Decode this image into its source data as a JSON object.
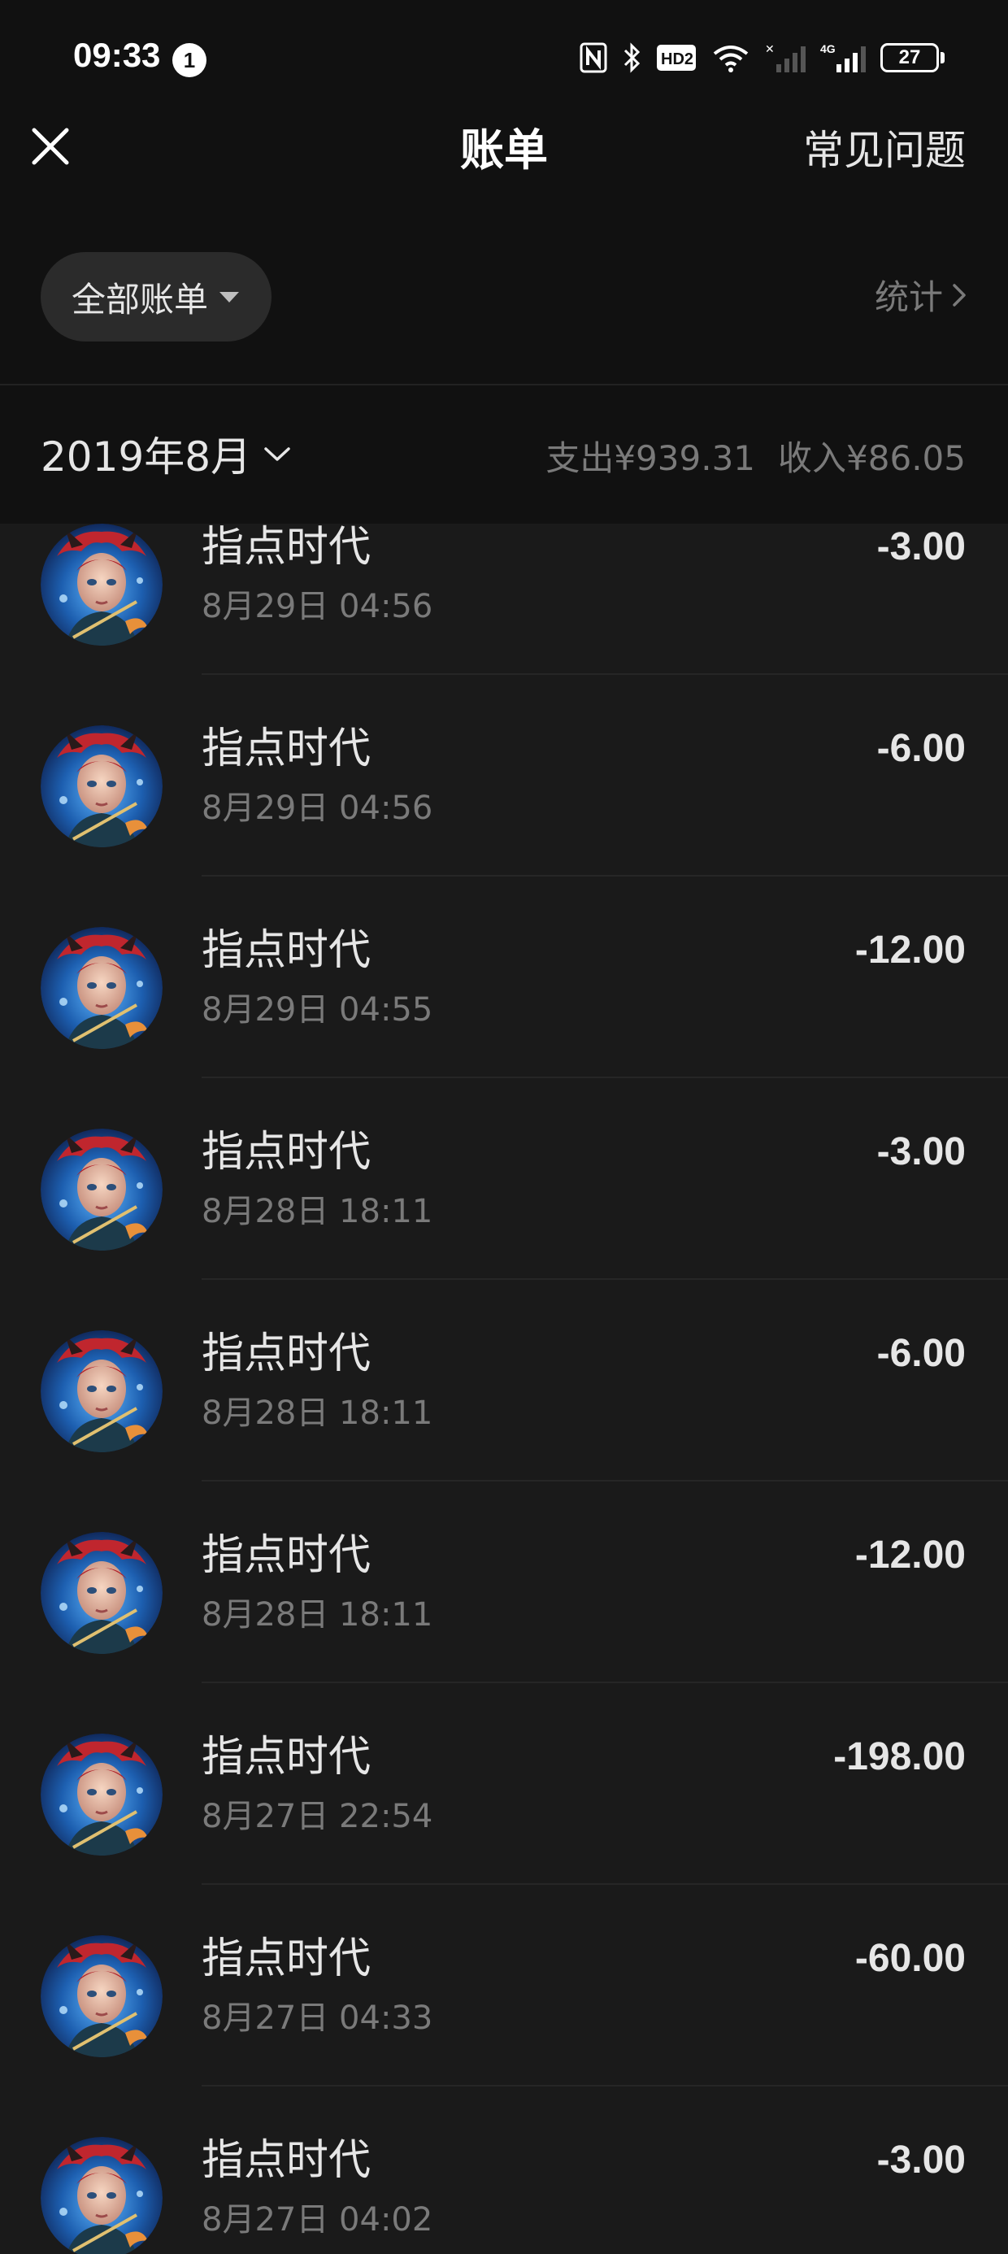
{
  "status_bar": {
    "time": "09:33",
    "notification_count": "1",
    "battery_level": "27",
    "network_label": "4G",
    "hd_label": "HD2"
  },
  "header": {
    "title": "账单",
    "faq_label": "常见问题",
    "filter_label": "全部账单",
    "stats_label": "统计"
  },
  "month": {
    "label": "2019年8月",
    "expense_label": "支出",
    "expense_value": "¥939.31",
    "income_label": "收入",
    "income_value": "¥86.05"
  },
  "transactions": [
    {
      "name": "指点时代",
      "time": "8月29日 04:56",
      "amount": "-3.00"
    },
    {
      "name": "指点时代",
      "time": "8月29日 04:56",
      "amount": "-6.00"
    },
    {
      "name": "指点时代",
      "time": "8月29日 04:55",
      "amount": "-12.00"
    },
    {
      "name": "指点时代",
      "time": "8月28日 18:11",
      "amount": "-3.00"
    },
    {
      "name": "指点时代",
      "time": "8月28日 18:11",
      "amount": "-6.00"
    },
    {
      "name": "指点时代",
      "time": "8月28日 18:11",
      "amount": "-12.00"
    },
    {
      "name": "指点时代",
      "time": "8月27日 22:54",
      "amount": "-198.00"
    },
    {
      "name": "指点时代",
      "time": "8月27日 04:33",
      "amount": "-60.00"
    },
    {
      "name": "指点时代",
      "time": "8月27日 04:02",
      "amount": "-3.00"
    }
  ],
  "icons": {
    "close": "close-icon",
    "filter_caret": "caret-down-icon",
    "stats_arrow": "chevron-right-icon",
    "month_arrow": "chevron-down-icon",
    "avatar": "game-character-avatar"
  }
}
